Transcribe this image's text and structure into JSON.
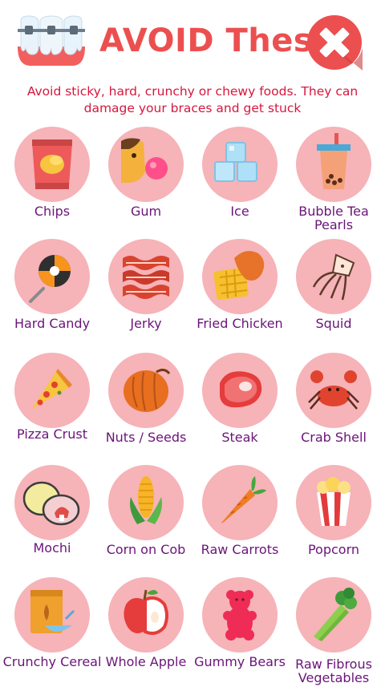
{
  "header": {
    "title": "AVOID These",
    "subtitle": "Avoid sticky, hard, crunchy or chewy foods. They can damage your braces and get stuck"
  },
  "colors": {
    "accent": "#ec4f4f",
    "subtitle": "#d6173e",
    "label": "#6b1479",
    "circle": "#f6b3b8"
  },
  "items": [
    {
      "label": "Chips",
      "icon": "chips-bag-icon"
    },
    {
      "label": "Gum",
      "icon": "bubble-gum-icon"
    },
    {
      "label": "Ice",
      "icon": "ice-cubes-icon"
    },
    {
      "label": "Bubble Tea Pearls",
      "icon": "bubble-tea-icon"
    },
    {
      "label": "Hard Candy",
      "icon": "lollipop-icon"
    },
    {
      "label": "Jerky",
      "icon": "jerky-icon"
    },
    {
      "label": "Fried Chicken",
      "icon": "fried-chicken-waffle-icon"
    },
    {
      "label": "Squid",
      "icon": "squid-icon"
    },
    {
      "label": "Pizza Crust",
      "icon": "pizza-slice-icon"
    },
    {
      "label": "Nuts / Seeds",
      "icon": "nut-icon"
    },
    {
      "label": "Steak",
      "icon": "steak-icon"
    },
    {
      "label": "Crab Shell",
      "icon": "crab-icon"
    },
    {
      "label": "Mochi",
      "icon": "mochi-icon"
    },
    {
      "label": "Corn on Cob",
      "icon": "corn-icon"
    },
    {
      "label": "Raw Carrots",
      "icon": "carrot-icon"
    },
    {
      "label": "Popcorn",
      "icon": "popcorn-icon"
    },
    {
      "label": "Crunchy Cereal",
      "icon": "cereal-icon"
    },
    {
      "label": "Whole Apple",
      "icon": "apple-icon"
    },
    {
      "label": "Gummy Bears",
      "icon": "gummy-bear-icon"
    },
    {
      "label": "Raw Fibrous Vegetables",
      "icon": "celery-icon"
    }
  ]
}
